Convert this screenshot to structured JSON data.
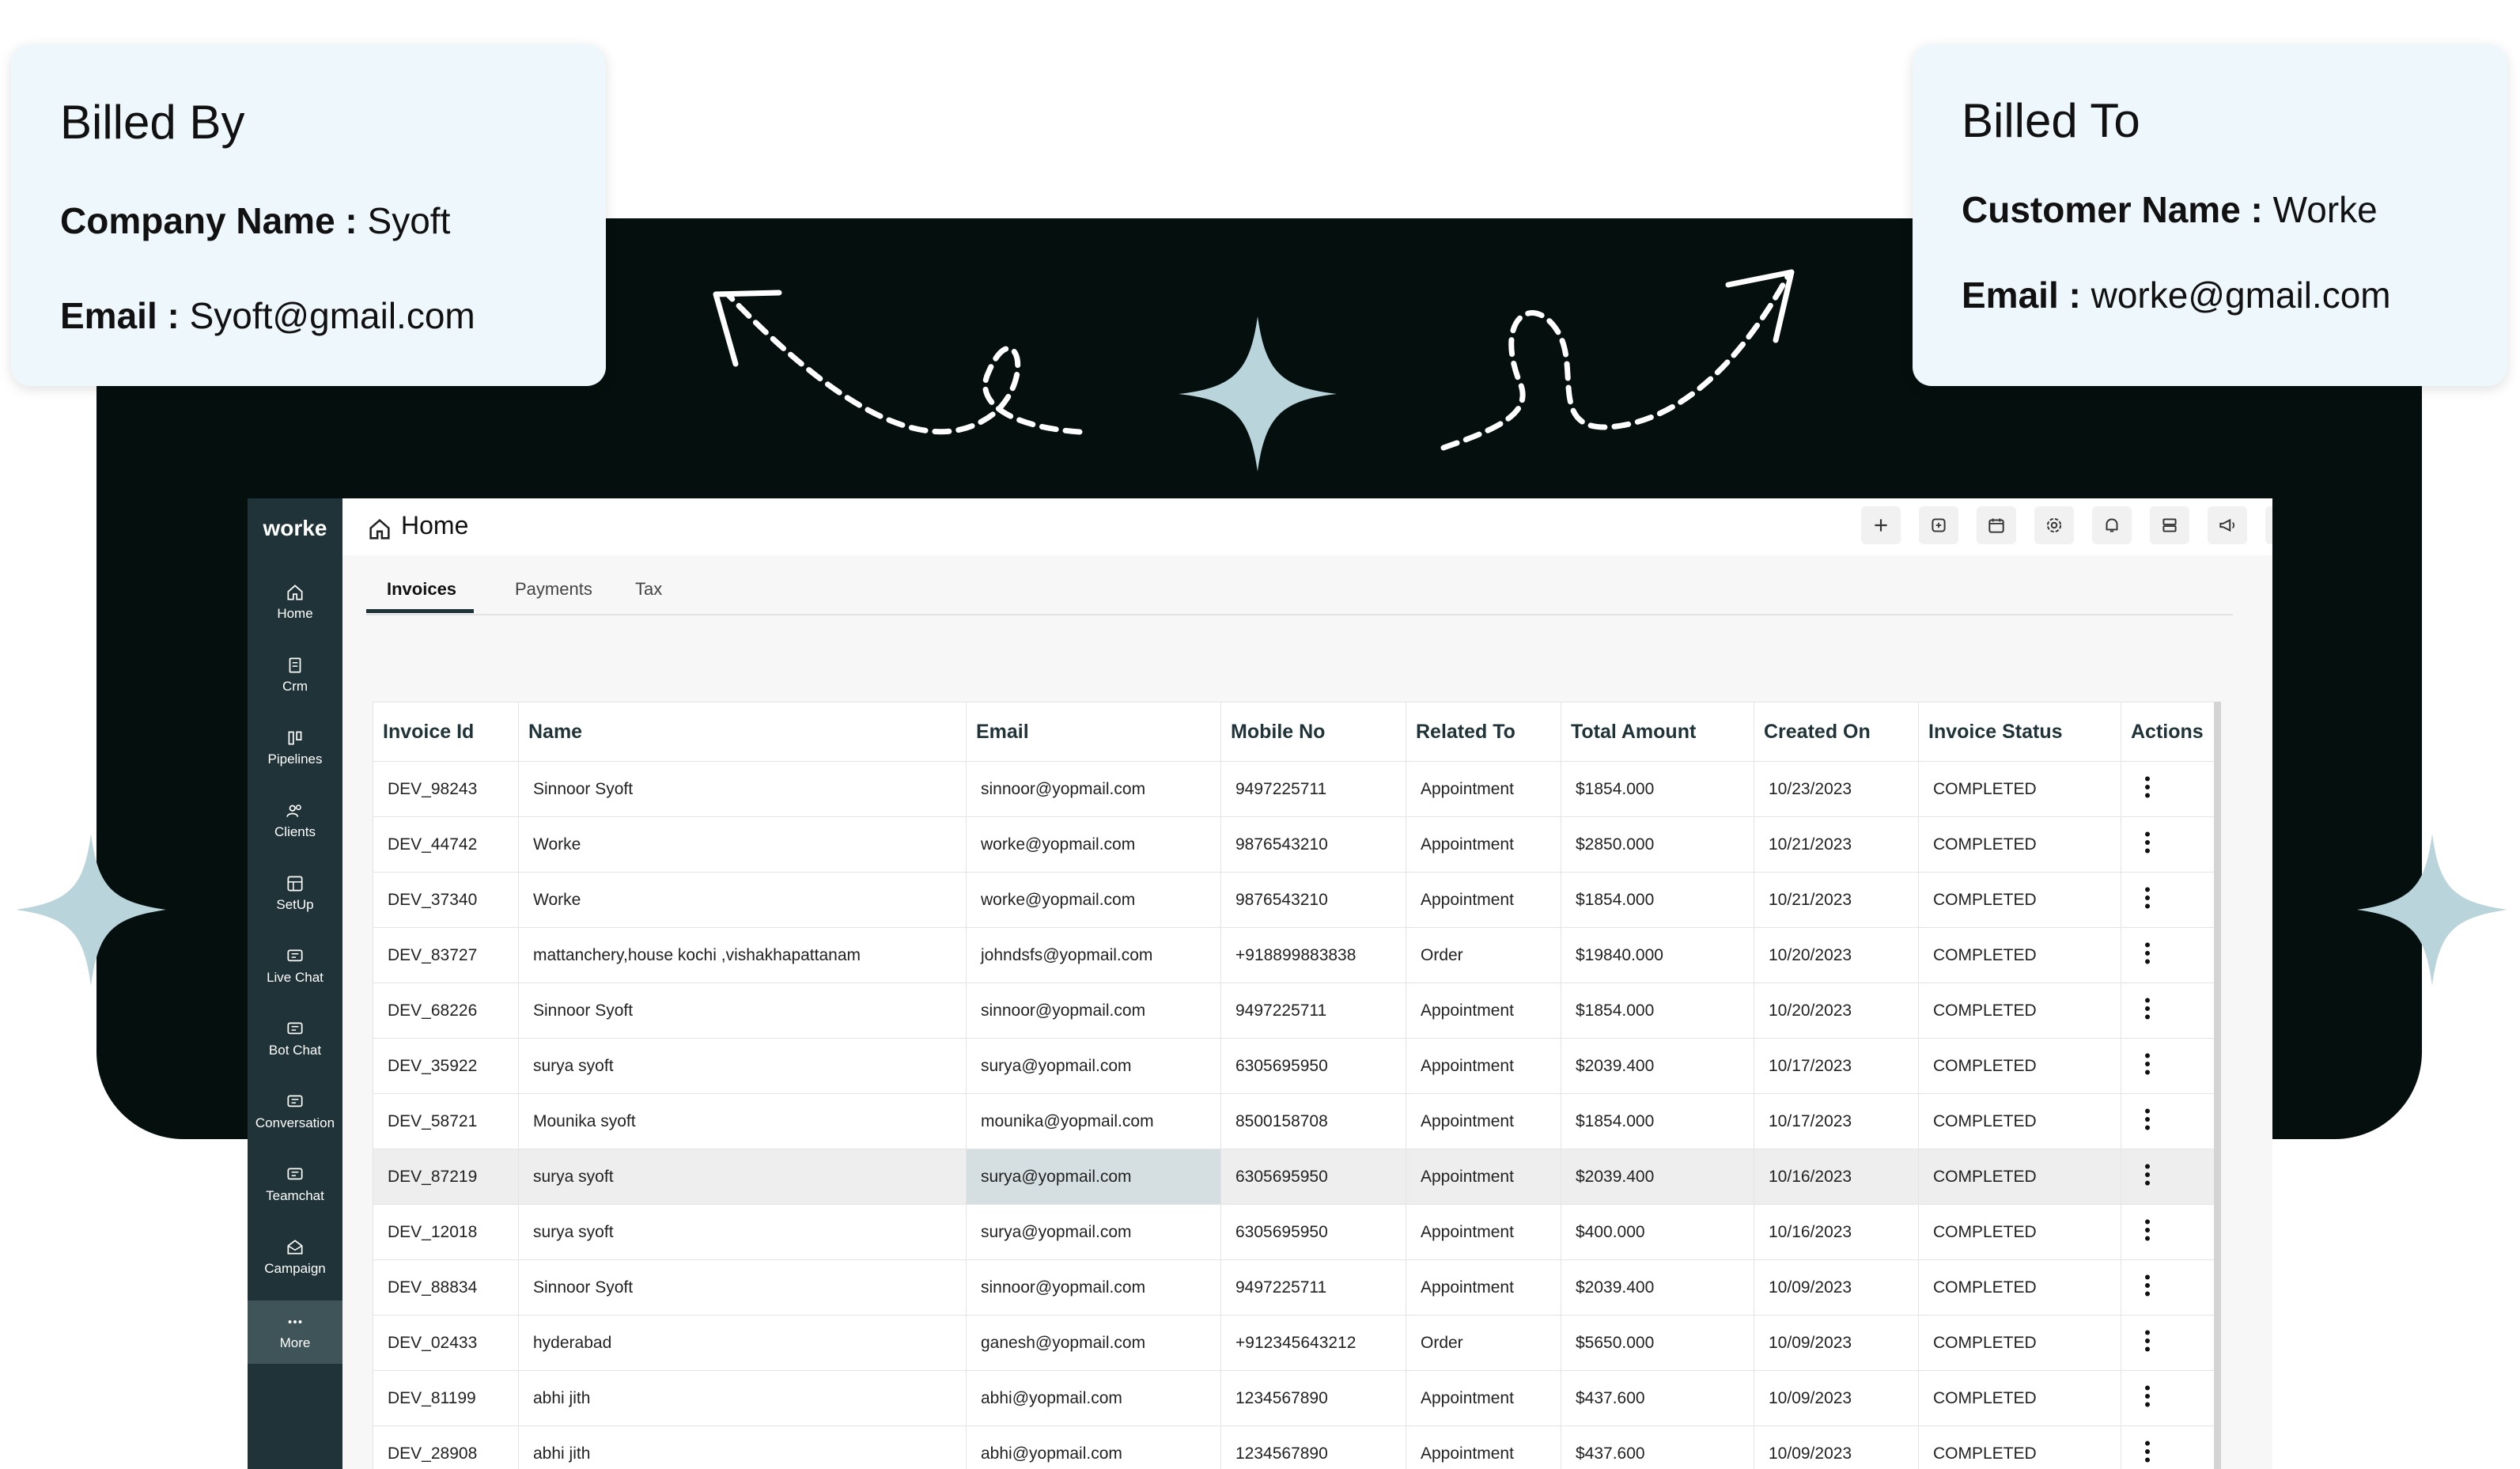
{
  "billed_by": {
    "title": "Billed By",
    "company_label": "Company Name :",
    "company_value": "Syoft",
    "email_label": "Email :",
    "email_value": "Syoft@gmail.com"
  },
  "billed_to": {
    "title": "Billed To",
    "customer_label": "Customer Name :",
    "customer_value": "Worke",
    "email_label": "Email :",
    "email_value": "worke@gmail.com"
  },
  "app": {
    "brand": "worke",
    "page_title": "Home",
    "sidebar": [
      {
        "label": "Home",
        "icon": "home-icon"
      },
      {
        "label": "Crm",
        "icon": "crm-icon"
      },
      {
        "label": "Pipelines",
        "icon": "pipelines-icon"
      },
      {
        "label": "Clients",
        "icon": "clients-icon"
      },
      {
        "label": "SetUp",
        "icon": "setup-icon"
      },
      {
        "label": "Live Chat",
        "icon": "chat-icon"
      },
      {
        "label": "Bot Chat",
        "icon": "chat-icon"
      },
      {
        "label": "Conversation",
        "icon": "chat-icon"
      },
      {
        "label": "Teamchat",
        "icon": "chat-icon"
      },
      {
        "label": "Campaign",
        "icon": "campaign-icon"
      },
      {
        "label": "More",
        "icon": "more-icon"
      }
    ],
    "toolbar_icons": [
      "plus-icon",
      "add-note-icon",
      "calendar-icon",
      "settings-icon",
      "bell-icon",
      "storage-icon",
      "megaphone-icon",
      "user-icon"
    ],
    "tabs": [
      {
        "label": "Invoices"
      },
      {
        "label": "Payments"
      },
      {
        "label": "Tax"
      }
    ],
    "columns": [
      "Invoice Id",
      "Name",
      "Email",
      "Mobile No",
      "Related To",
      "Total Amount",
      "Created On",
      "Invoice Status",
      "Actions"
    ],
    "rows": [
      [
        "DEV_98243",
        "Sinnoor Syoft",
        "sinnoor@yopmail.com",
        "9497225711",
        "Appointment",
        "$1854.000",
        "10/23/2023",
        "COMPLETED"
      ],
      [
        "DEV_44742",
        "Worke",
        "worke@yopmail.com",
        "9876543210",
        "Appointment",
        "$2850.000",
        "10/21/2023",
        "COMPLETED"
      ],
      [
        "DEV_37340",
        "Worke",
        "worke@yopmail.com",
        "9876543210",
        "Appointment",
        "$1854.000",
        "10/21/2023",
        "COMPLETED"
      ],
      [
        "DEV_83727",
        "mattanchery,house kochi ,vishakhapattanam",
        "johndsfs@yopmail.com",
        "+918899883838",
        "Order",
        "$19840.000",
        "10/20/2023",
        "COMPLETED"
      ],
      [
        "DEV_68226",
        "Sinnoor Syoft",
        "sinnoor@yopmail.com",
        "9497225711",
        "Appointment",
        "$1854.000",
        "10/20/2023",
        "COMPLETED"
      ],
      [
        "DEV_35922",
        "surya syoft",
        "surya@yopmail.com",
        "6305695950",
        "Appointment",
        "$2039.400",
        "10/17/2023",
        "COMPLETED"
      ],
      [
        "DEV_58721",
        "Mounika syoft",
        "mounika@yopmail.com",
        "8500158708",
        "Appointment",
        "$1854.000",
        "10/17/2023",
        "COMPLETED"
      ],
      [
        "DEV_87219",
        "surya syoft",
        "surya@yopmail.com",
        "6305695950",
        "Appointment",
        "$2039.400",
        "10/16/2023",
        "COMPLETED"
      ],
      [
        "DEV_12018",
        "surya syoft",
        "surya@yopmail.com",
        "6305695950",
        "Appointment",
        "$400.000",
        "10/16/2023",
        "COMPLETED"
      ],
      [
        "DEV_88834",
        "Sinnoor Syoft",
        "sinnoor@yopmail.com",
        "9497225711",
        "Appointment",
        "$2039.400",
        "10/09/2023",
        "COMPLETED"
      ],
      [
        "DEV_02433",
        "hyderabad",
        "ganesh@yopmail.com",
        "+912345643212",
        "Order",
        "$5650.000",
        "10/09/2023",
        "COMPLETED"
      ],
      [
        "DEV_81199",
        "abhi jith",
        "abhi@yopmail.com",
        "1234567890",
        "Appointment",
        "$437.600",
        "10/09/2023",
        "COMPLETED"
      ],
      [
        "DEV_28908",
        "abhi jith",
        "abhi@yopmail.com",
        "1234567890",
        "Appointment",
        "$437.600",
        "10/09/2023",
        "COMPLETED"
      ]
    ],
    "colors": {
      "sidebar": "#1f3338",
      "accent_star": "#b9d4db",
      "card_bg": "#eef8fc"
    }
  }
}
